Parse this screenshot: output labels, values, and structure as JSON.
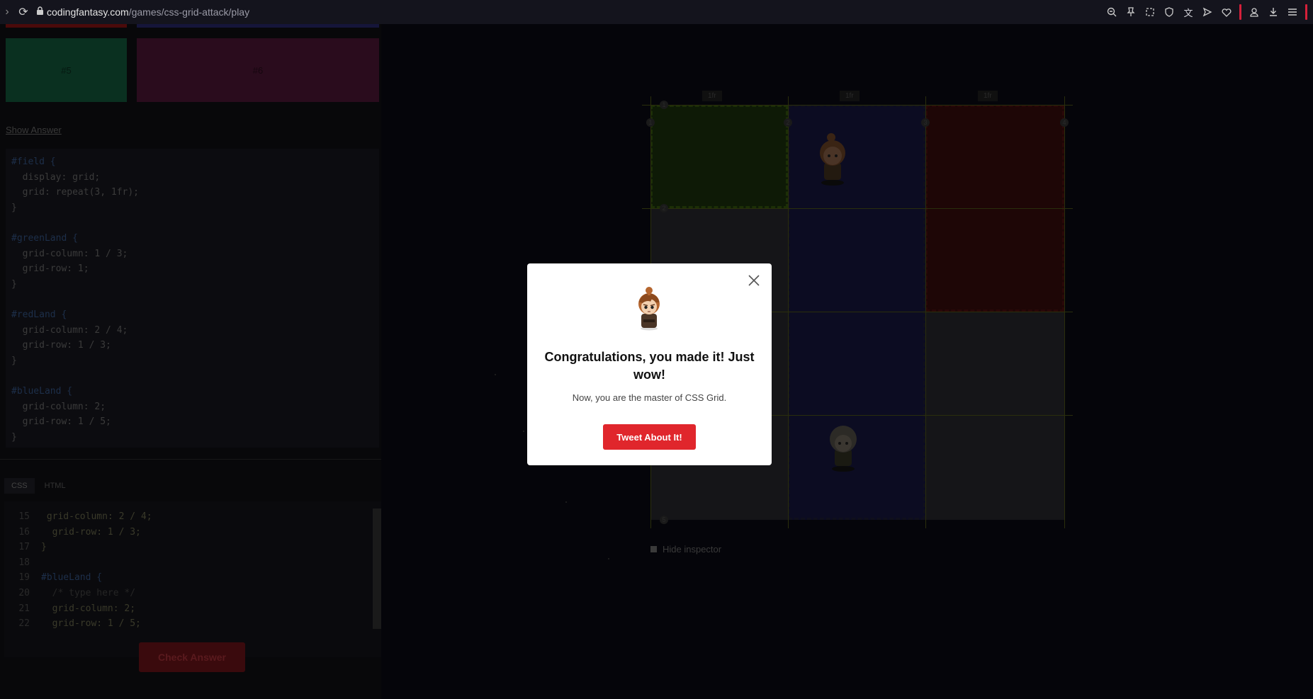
{
  "browser": {
    "url_domain": "codingfantasy.com",
    "url_path": "/games/css-grid-attack/play"
  },
  "left_panel": {
    "tiles": [
      {
        "label": "#5",
        "color": "#0a3020"
      },
      {
        "label": "#6",
        "color": "#2a0c1d"
      }
    ],
    "show_answer": "Show Answer",
    "answer_code": [
      "#field {",
      "  display: grid;",
      "  grid: repeat(3, 1fr);",
      "}",
      "",
      "#greenLand {",
      "  grid-column: 1 / 3;",
      "  grid-row: 1;",
      "}",
      "",
      "#redLand {",
      "  grid-column: 2 / 4;",
      "  grid-row: 1 / 3;",
      "}",
      "",
      "#blueLand {",
      "  grid-column: 2;",
      "  grid-row: 1 / 5;",
      "}"
    ],
    "tabs": [
      "CSS",
      "HTML"
    ],
    "editor_lines": [
      {
        "num": "15",
        "text": " grid-column: 2 / 4;"
      },
      {
        "num": "16",
        "text": "  grid-row: 1 / 3;"
      },
      {
        "num": "17",
        "text": "}"
      },
      {
        "num": "18",
        "text": ""
      },
      {
        "num": "19",
        "text": "#blueLand {"
      },
      {
        "num": "20",
        "text": "  /* type here */"
      },
      {
        "num": "21",
        "text": "  grid-column: 2;"
      },
      {
        "num": "22",
        "text": "  grid-row: 1 / 5;"
      }
    ],
    "check_answer": "Check Answer"
  },
  "field": {
    "fr_labels": [
      "1fr",
      "1fr",
      "1fr"
    ],
    "col_numbers": [
      "1",
      "2",
      "3",
      "4"
    ],
    "row_numbers": [
      "1",
      "2",
      "5"
    ],
    "hide_inspector": "Hide inspector"
  },
  "modal": {
    "title": "Congratulations, you made it! Just wow!",
    "subtitle": "Now, you are the master of CSS Grid.",
    "button": "Tweet About It!",
    "accent": "#e0262c"
  }
}
